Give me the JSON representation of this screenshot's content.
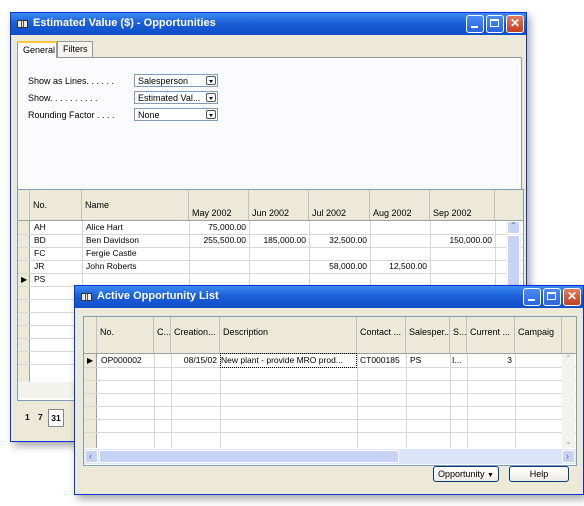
{
  "back_window": {
    "title": "Estimated Value ($) - Opportunities",
    "tabs": [
      "General",
      "Filters"
    ],
    "fields": [
      {
        "label": "Show as Lines. . . . . .",
        "value": "Salesperson"
      },
      {
        "label": "Show. . . . . . . . . .",
        "value": "Estimated Val..."
      },
      {
        "label": "Rounding Factor . . . .",
        "value": "None"
      }
    ],
    "grid": {
      "columns": [
        "No.",
        "Name",
        "May 2002",
        "Jun 2002",
        "Jul 2002",
        "Aug 2002",
        "Sep 2002"
      ],
      "rows": [
        {
          "no": "AH",
          "name": "Alice Hart",
          "may": "75,000.00",
          "jun": "",
          "jul": "",
          "aug": "",
          "sep": ""
        },
        {
          "no": "BD",
          "name": "Ben Davidson",
          "may": "255,500.00",
          "jun": "185,000.00",
          "jul": "32,500.00",
          "aug": "",
          "sep": "150,000.00"
        },
        {
          "no": "FC",
          "name": "Fergie Castle",
          "may": "",
          "jun": "",
          "jul": "",
          "aug": "",
          "sep": ""
        },
        {
          "no": "JR",
          "name": "John Roberts",
          "may": "",
          "jun": "",
          "jul": "58,000.00",
          "aug": "12,500.00",
          "sep": ""
        },
        {
          "no": "PS",
          "name": "",
          "may": "",
          "jun": "",
          "jul": "",
          "aug": "",
          "sep": ""
        }
      ]
    },
    "pager": [
      "1",
      "7",
      "31"
    ]
  },
  "front_window": {
    "title": "Active Opportunity List",
    "grid": {
      "columns": [
        "No.",
        "C...",
        "Creation...",
        "Description",
        "Contact ...",
        "Salesper...",
        "S...",
        "Current ...",
        "Campaig"
      ],
      "rows": [
        {
          "no": "OP000002",
          "c": "",
          "creation": "08/15/02",
          "description": "New plant - provide MRO prod...",
          "contact": "CT000185",
          "salesperson": "PS",
          "s": "I...",
          "current": "3",
          "campaign": ""
        }
      ]
    },
    "buttons": {
      "opportunity": "Opportunity",
      "help": "Help"
    }
  },
  "colors": {
    "titlebar": "#0f4ec7",
    "window_face": "#ece9d8",
    "close_button": "#c3401e"
  }
}
